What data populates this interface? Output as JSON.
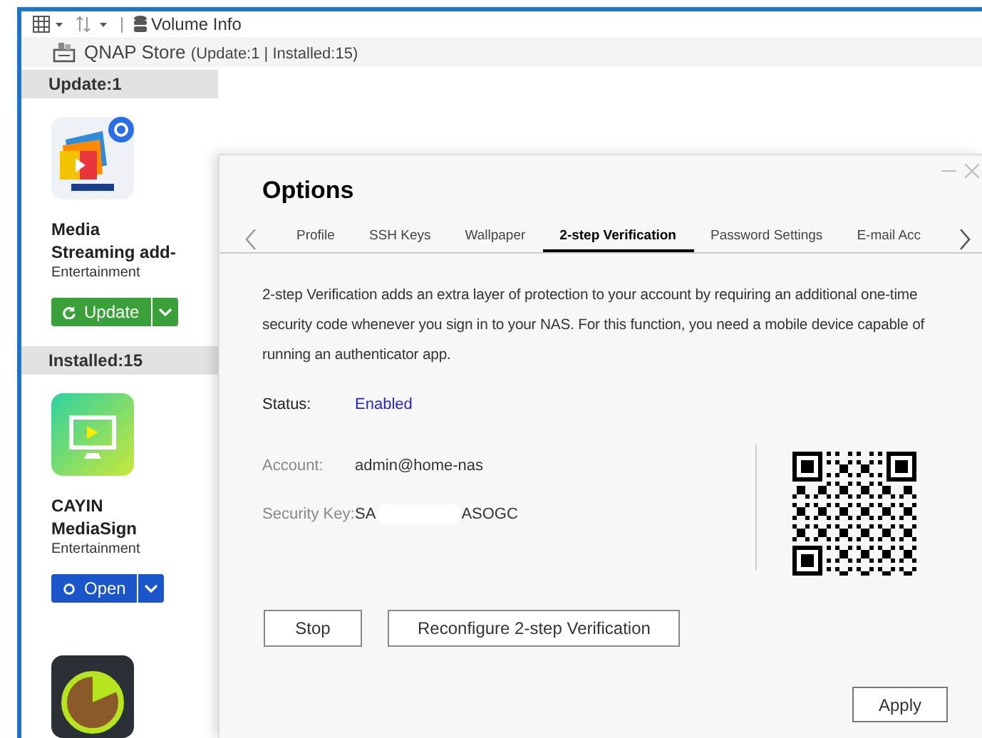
{
  "toolbar": {
    "volume_info": "Volume Info"
  },
  "store": {
    "title": "QNAP Store",
    "counts": "(Update:1 | Installed:15)"
  },
  "sections": [
    {
      "heading": "Update:1",
      "apps": [
        {
          "kind": "media",
          "name": "Media Streaming add-",
          "category": "Entertainment",
          "action": {
            "kind": "update",
            "label": "Update"
          }
        }
      ]
    },
    {
      "heading": "Installed:15",
      "apps": [
        {
          "kind": "display",
          "name": "CAYIN MediaSign",
          "category": "Entertainment",
          "action": {
            "kind": "open",
            "label": "Open"
          }
        },
        {
          "kind": "timer"
        }
      ]
    }
  ],
  "dialog": {
    "title": "Options",
    "tabs": [
      {
        "label": "Profile",
        "selected": false
      },
      {
        "label": "SSH Keys",
        "selected": false
      },
      {
        "label": "Wallpaper",
        "selected": false
      },
      {
        "label": "2-step Verification",
        "selected": true
      },
      {
        "label": "Password Settings",
        "selected": false
      },
      {
        "label": "E-mail Acc",
        "selected": false
      }
    ],
    "description": "2-step Verification adds an extra layer of protection to your account by requiring an additional one-time security code whenever you sign in to your NAS. For this function, you need a mobile device capable of running an authenticator app.",
    "status": {
      "label": "Status:",
      "value": "Enabled"
    },
    "account": {
      "label": "Account:",
      "value": "admin@home-nas"
    },
    "security_key": {
      "label": "Security Key:",
      "value_start": "SA",
      "value_end": "ASOGC"
    },
    "buttons": [
      "Stop",
      "Reconfigure 2-step Verification"
    ],
    "apply": "Apply"
  }
}
